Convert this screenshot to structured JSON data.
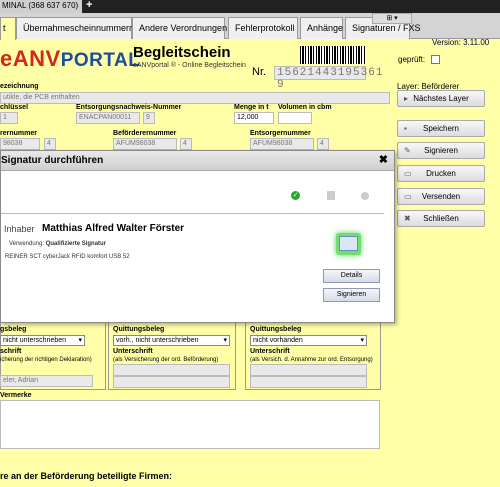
{
  "window": {
    "tab_title": "MINAL (368 637 670)",
    "new_tab": "+"
  },
  "doc_tabs": [
    "t",
    "Übernahmescheinnummern",
    "Andere Verordnungen",
    "Fehlerprotokoll",
    "Anhänge",
    "Signaturen / FXS"
  ],
  "window_controls": "⊞  ▾",
  "version": "Version: 3.11.00",
  "logo": {
    "part1": "eANV",
    "part2": "PORTAL"
  },
  "document": {
    "title": "Begleitschein",
    "subtitle": "eANVportal ® - Online Begleitschein",
    "nr_label": "Nr.",
    "nr_value": "15621443195361 9"
  },
  "fields": {
    "bezeichnung_label": "ezeichnung",
    "bezeichnung_value": "utikle, die PCB enthalten",
    "schluessel_label": "chlüssel",
    "schluessel_value": "1",
    "entsorgungsnachweis_label": "Entsorgungsnachweis-Nummer",
    "entsorgungsnachweis_value": "ENACPAN00011",
    "entsorgungsnachweis_check": "9",
    "menge_label": "Menge in t",
    "menge_value": "12,000",
    "volumen_label": "Volumen in cbm",
    "volumen_value": "",
    "erzeugernummer_label": "rernummer",
    "erzeugernummer_value": "98038",
    "erzeugernummer_check": "4",
    "befoerderernummer_label": "Beförderernummer",
    "befoerderernummer_value": "AFUM98038",
    "befoerderernummer_check": "4",
    "entsorgernummer_label": "Entsorgernummer",
    "entsorgernummer_value": "AFUM98038",
    "entsorgernummer_check": "4"
  },
  "sidebar": {
    "geprueft": "geprüft:",
    "layer_label": "Layer: Beförderer",
    "next_layer": "Nächstes Layer",
    "buttons": [
      "Speichern",
      "Signieren",
      "Drucken",
      "Versenden",
      "Schließen"
    ]
  },
  "dialog": {
    "title": "Signatur durchführen",
    "close": "✖",
    "inhaber_label": "Inhaber",
    "inhaber_name": "Matthias Alfred Walter Förster",
    "verwendung_label": "Verwendung:",
    "verwendung_value": "Qualifizierte Signatur",
    "reader": "REINER SCT cyberJack RFID komfort USB 52",
    "details_btn": "Details",
    "signieren_btn": "Signieren"
  },
  "quittung": {
    "col1": {
      "label": "gsbeleg",
      "select": "nicht unterschrieben",
      "unterschrift": "schrift",
      "note": "icherung der richtigen Deklaration)",
      "name": "eler, Adrian"
    },
    "col2": {
      "label": "Quittungsbeleg",
      "select": "vorh., nicht unterschrieben",
      "unterschrift": "Unterschrift",
      "note": "(als Versicherung der ord. Beförderung)",
      "name": ""
    },
    "col3": {
      "label": "Quittungsbeleg",
      "select": "nicht vorhanden",
      "unterschrift": "Unterschrift",
      "note": "(als Versich. d. Annahme zur ord. Entsorgung)",
      "name": ""
    }
  },
  "vermerke_label": "Vermerke",
  "bottom_label": "re an der Beförderung beteiligte Firmen:"
}
